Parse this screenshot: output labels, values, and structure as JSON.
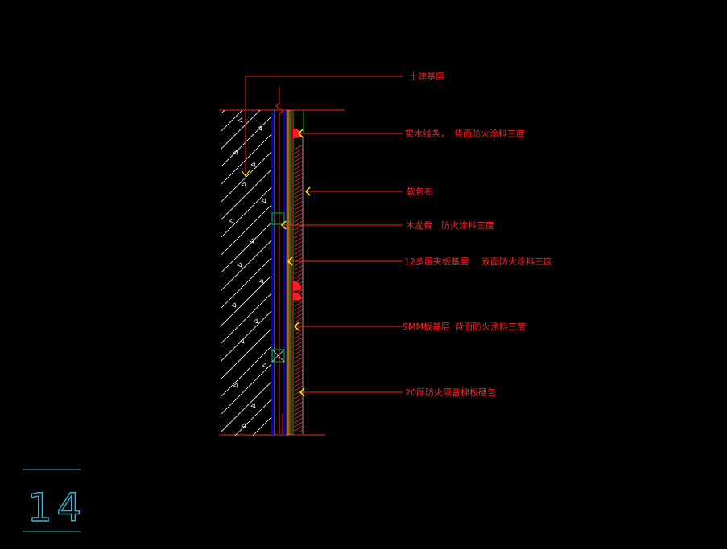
{
  "drawing": {
    "callouts": [
      {
        "id": "c1",
        "parts": [
          "土建基层"
        ]
      },
      {
        "id": "c2",
        "parts": [
          "实木线条，",
          "背面防火涂料三度"
        ]
      },
      {
        "id": "c3",
        "parts": [
          "软包布"
        ]
      },
      {
        "id": "c4",
        "parts": [
          "木龙骨",
          "防火涂料三度"
        ]
      },
      {
        "id": "c5",
        "parts": [
          "12多层夹板基层",
          "双面防火涂料三度"
        ]
      },
      {
        "id": "c6",
        "parts": [
          "9MM板基层",
          "背面防火涂料三度"
        ]
      },
      {
        "id": "c7",
        "parts": [
          "20厚防火隔音棉板硬包"
        ]
      }
    ],
    "detail_number": "14",
    "colors": {
      "background": "#000000",
      "annotation": "#ff2020",
      "wall_hatch": "#ffffff",
      "frame_line": "#0000ff",
      "batten": "#00c000",
      "panel_line": "#ffff00",
      "leader": "#ff2020",
      "detail_number": "#2fb8d8"
    }
  }
}
